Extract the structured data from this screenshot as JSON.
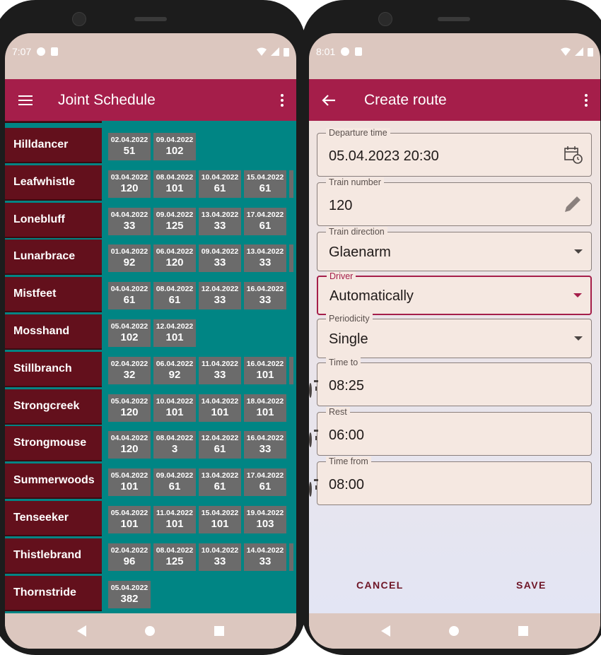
{
  "left_screen": {
    "status_time": "7:07",
    "app_title": "Joint Schedule",
    "rows": [
      {
        "name": "Hilldancer",
        "cells": [
          {
            "date": "02.04.2022",
            "value": "51"
          },
          {
            "date": "09.04.2022",
            "value": "102"
          }
        ],
        "more": false
      },
      {
        "name": "Leafwhistle",
        "cells": [
          {
            "date": "03.04.2022",
            "value": "120"
          },
          {
            "date": "08.04.2022",
            "value": "101"
          },
          {
            "date": "10.04.2022",
            "value": "61"
          },
          {
            "date": "15.04.2022",
            "value": "61"
          }
        ],
        "more": true
      },
      {
        "name": "Lonebluff",
        "cells": [
          {
            "date": "04.04.2022",
            "value": "33"
          },
          {
            "date": "09.04.2022",
            "value": "125"
          },
          {
            "date": "13.04.2022",
            "value": "33"
          },
          {
            "date": "17.04.2022",
            "value": "61"
          }
        ],
        "more": false
      },
      {
        "name": "Lunarbrace",
        "cells": [
          {
            "date": "01.04.2022",
            "value": "92"
          },
          {
            "date": "06.04.2022",
            "value": "120"
          },
          {
            "date": "09.04.2022",
            "value": "33"
          },
          {
            "date": "13.04.2022",
            "value": "33"
          }
        ],
        "more": true
      },
      {
        "name": "Mistfeet",
        "cells": [
          {
            "date": "04.04.2022",
            "value": "61"
          },
          {
            "date": "08.04.2022",
            "value": "61"
          },
          {
            "date": "12.04.2022",
            "value": "33"
          },
          {
            "date": "16.04.2022",
            "value": "33"
          }
        ],
        "more": false
      },
      {
        "name": "Mosshand",
        "cells": [
          {
            "date": "05.04.2022",
            "value": "102"
          },
          {
            "date": "12.04.2022",
            "value": "101"
          }
        ],
        "more": false
      },
      {
        "name": "Stillbranch",
        "cells": [
          {
            "date": "02.04.2022",
            "value": "32"
          },
          {
            "date": "06.04.2022",
            "value": "92"
          },
          {
            "date": "11.04.2022",
            "value": "33"
          },
          {
            "date": "16.04.2022",
            "value": "101"
          }
        ],
        "more": true
      },
      {
        "name": "Strongcreek",
        "cells": [
          {
            "date": "05.04.2022",
            "value": "120"
          },
          {
            "date": "10.04.2022",
            "value": "101"
          },
          {
            "date": "14.04.2022",
            "value": "101"
          },
          {
            "date": "18.04.2022",
            "value": "101"
          }
        ],
        "more": false
      },
      {
        "name": "Strongmouse",
        "cells": [
          {
            "date": "04.04.2022",
            "value": "120"
          },
          {
            "date": "08.04.2022",
            "value": "3"
          },
          {
            "date": "12.04.2022",
            "value": "61"
          },
          {
            "date": "16.04.2022",
            "value": "33"
          }
        ],
        "more": false
      },
      {
        "name": "Summerwoods",
        "cells": [
          {
            "date": "05.04.2022",
            "value": "101"
          },
          {
            "date": "09.04.2022",
            "value": "61"
          },
          {
            "date": "13.04.2022",
            "value": "61"
          },
          {
            "date": "17.04.2022",
            "value": "61"
          }
        ],
        "more": false
      },
      {
        "name": "Tenseeker",
        "cells": [
          {
            "date": "05.04.2022",
            "value": "101"
          },
          {
            "date": "11.04.2022",
            "value": "101"
          },
          {
            "date": "15.04.2022",
            "value": "101"
          },
          {
            "date": "19.04.2022",
            "value": "103"
          }
        ],
        "more": false
      },
      {
        "name": "Thistlebrand",
        "cells": [
          {
            "date": "02.04.2022",
            "value": "96"
          },
          {
            "date": "08.04.2022",
            "value": "125"
          },
          {
            "date": "10.04.2022",
            "value": "33"
          },
          {
            "date": "14.04.2022",
            "value": "33"
          }
        ],
        "more": true
      },
      {
        "name": "Thornstride",
        "cells": [
          {
            "date": "05.04.2022",
            "value": "382"
          }
        ],
        "more": false
      }
    ]
  },
  "right_screen": {
    "status_time": "8:01",
    "app_title": "Create route",
    "fields": {
      "departure_time": {
        "label": "Departure time",
        "value": "05.04.2023 20:30"
      },
      "train_number": {
        "label": "Train number",
        "value": "120"
      },
      "train_direction": {
        "label": "Train direction",
        "value": "Glaenarm"
      },
      "driver": {
        "label": "Driver",
        "value": "Automatically"
      },
      "periodicity": {
        "label": "Periodicity",
        "value": "Single"
      },
      "time_to": {
        "label": "Time to",
        "value": "08:25"
      },
      "rest": {
        "label": "Rest",
        "value": "06:00"
      },
      "time_from": {
        "label": "Time from",
        "value": "08:00"
      }
    },
    "cancel_label": "CANCEL",
    "save_label": "SAVE"
  },
  "colors": {
    "primary": "#a51e4a",
    "teal": "#008584",
    "name_cell": "#63101c",
    "date_cell": "#6b6b6b"
  },
  "icons": [
    "menu-icon",
    "more-vert-icon",
    "back-arrow-icon",
    "calendar-clock-icon",
    "pencil-icon",
    "dropdown-caret-icon",
    "stopwatch-icon",
    "wifi-icon",
    "signal-icon",
    "battery-icon",
    "nav-back-icon",
    "nav-home-icon",
    "nav-recent-icon"
  ]
}
